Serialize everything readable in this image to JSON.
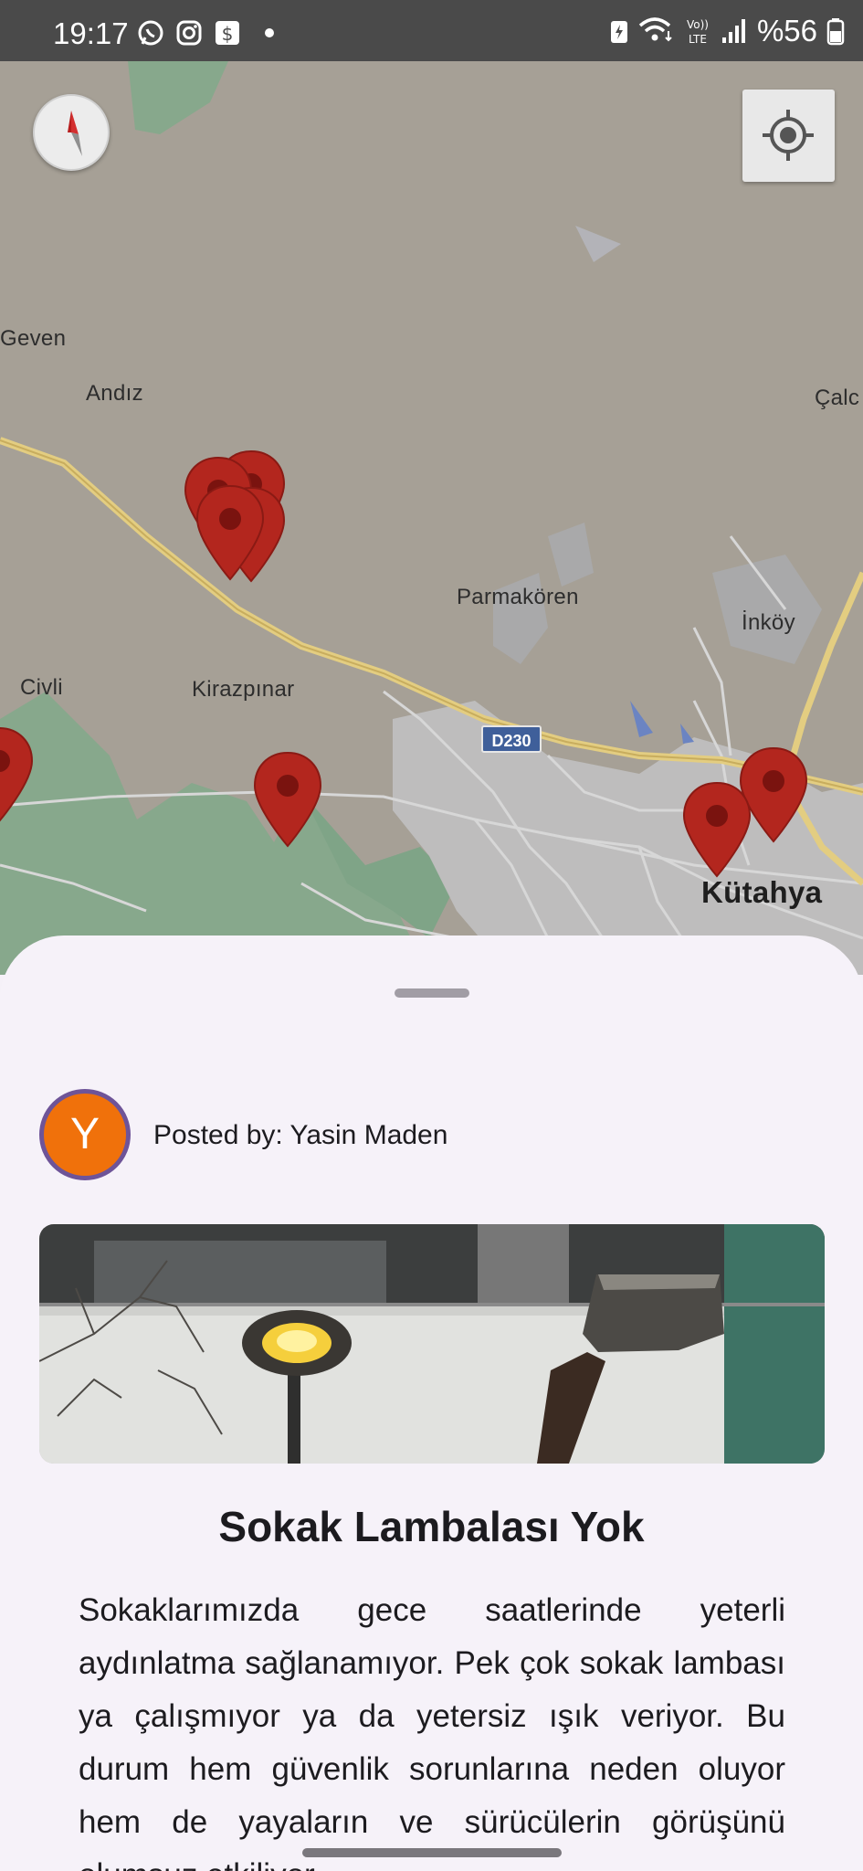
{
  "status_bar": {
    "time": "19:17",
    "battery": "%56",
    "notification_icons": [
      "whatsapp-icon",
      "instagram-icon",
      "dollar-app-icon"
    ],
    "system_icons": [
      "battery-saver-icon",
      "wifi-icon",
      "volte-icon",
      "signal-icon",
      "battery-icon"
    ]
  },
  "map": {
    "labels": {
      "geven": "Geven",
      "andiz": "Andız",
      "calc": "Çalc",
      "parmakoren": "Parmakören",
      "inkoy": "İnköy",
      "civli": "Civli",
      "kirazpinar": "Kirazpınar",
      "kutahya": "Kütahya"
    },
    "road_shield": "D230",
    "marker_color": "#b3261e",
    "marker_count": 7
  },
  "sheet": {
    "author_initial": "Y",
    "posted_by": "Posted by: Yasin Maden",
    "avatar_color": "#f0710b",
    "title": "Sokak Lambalası Yok",
    "description": "Sokaklarımızda gece saatlerinde yeterli aydınlatma sağlanamıyor. Pek çok sokak lambası ya çalışmıyor ya da yetersiz ışık veriyor. Bu durum hem güvenlik sorunlarına neden oluyor hem de yayaların ve sürücülerin görüşünü olumsuz etkiliyor."
  }
}
